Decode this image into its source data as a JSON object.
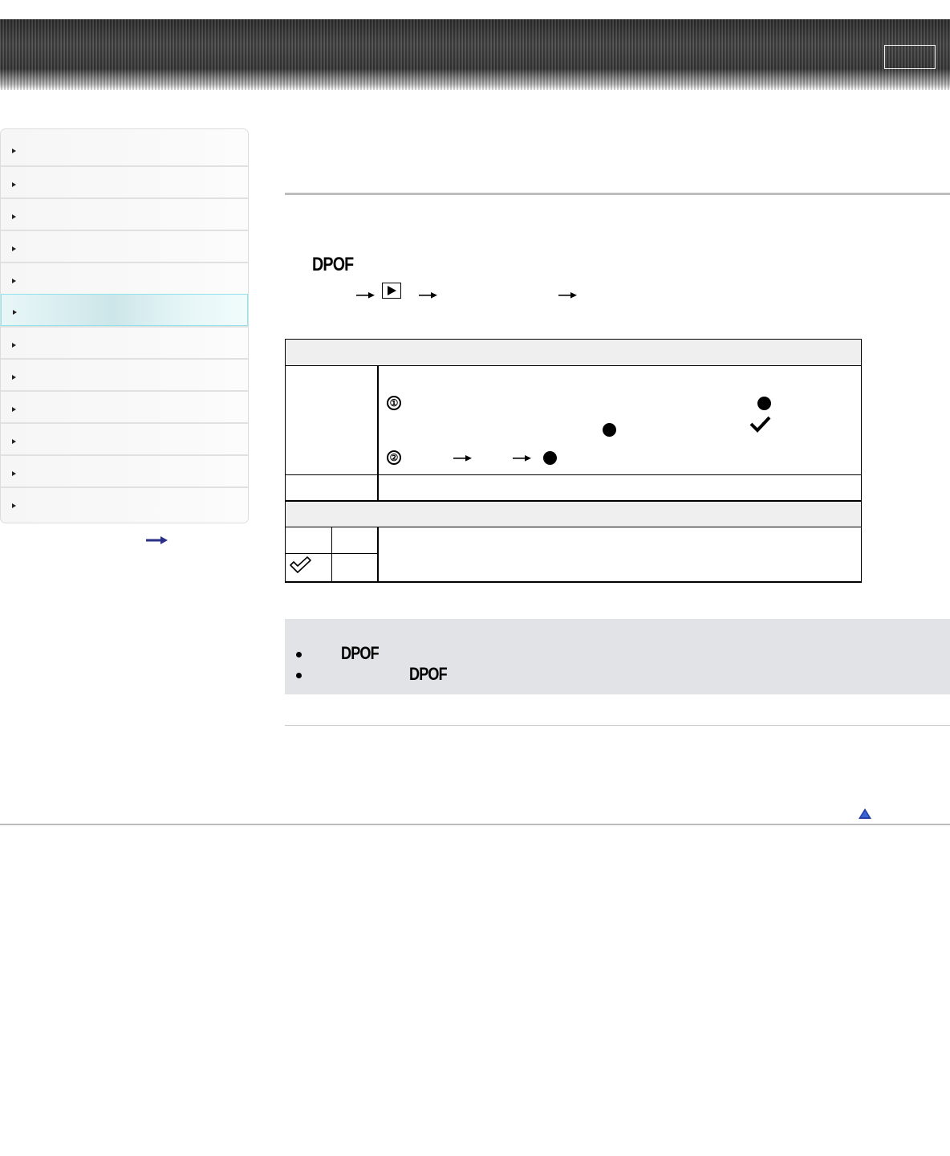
{
  "header": {
    "button_label": ""
  },
  "sidebar": {
    "items": [
      {
        "label": ""
      },
      {
        "label": ""
      },
      {
        "label": ""
      },
      {
        "label": ""
      },
      {
        "label": ""
      },
      {
        "label": "",
        "active": true
      },
      {
        "label": ""
      },
      {
        "label": ""
      },
      {
        "label": ""
      },
      {
        "label": ""
      },
      {
        "label": ""
      },
      {
        "label": ""
      }
    ],
    "more_icon": "right-arrow-icon"
  },
  "main": {
    "dpof_title": "DPOF",
    "menu_path_icons": [
      "right-arrow-icon",
      "playback-icon",
      "right-arrow-icon",
      "right-arrow-icon"
    ],
    "table": {
      "step_1_label": "①",
      "step_2_label": "②",
      "icons": [
        "filled-circle-icon",
        "checkmark-icon",
        "outline-checkmark-icon"
      ]
    },
    "notes": {
      "bullet_1_text": "DPOF",
      "bullet_2_text": "DPOF"
    }
  },
  "colors": {
    "active_nav": "#cde6e9",
    "active_nav_border": "#8fe3ef",
    "note_background": "#e1e3e7",
    "band_background": "#efefef",
    "accent_arrow": "#2a2f8c"
  }
}
